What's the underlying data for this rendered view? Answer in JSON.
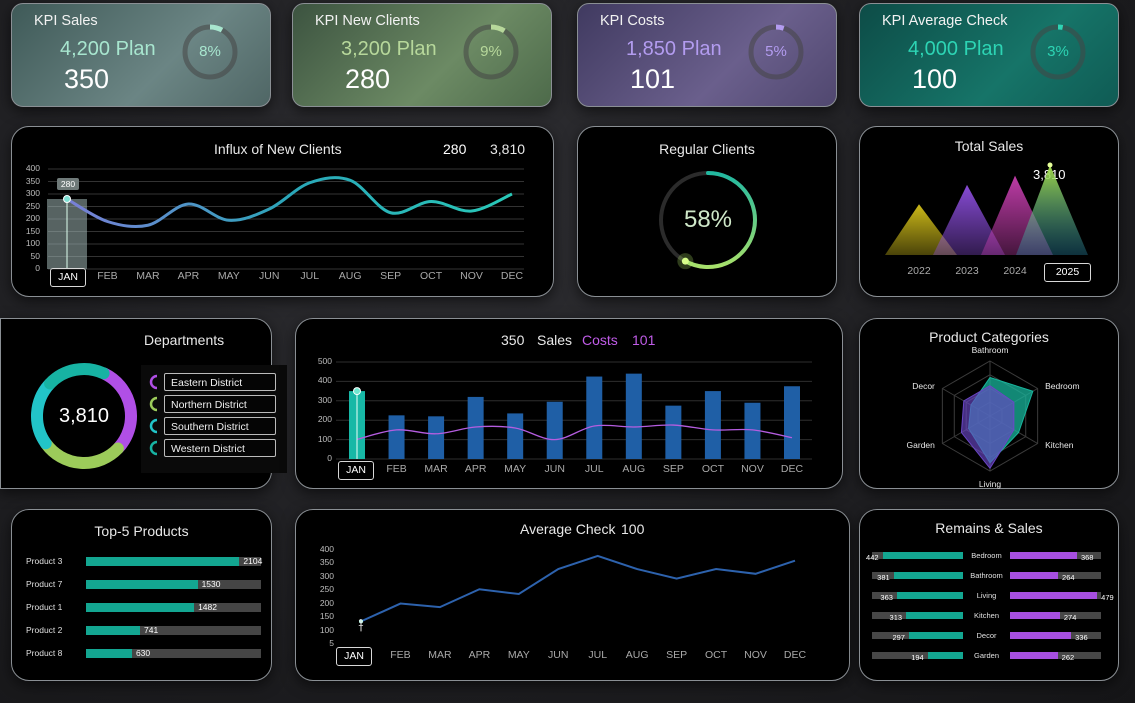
{
  "kpis": [
    {
      "title": "KPI Sales",
      "plan": "4,200 Plan",
      "value": "350",
      "pct": "8%",
      "pct_value": 8,
      "color": "#a8e6cf",
      "grad": "linear-gradient(135deg,#3f5a58,#6b8584 60%,#4f6665)"
    },
    {
      "title": "KPI New Clients",
      "plan": "3,200 Plan",
      "value": "280",
      "pct": "9%",
      "pct_value": 9,
      "color": "#b7d89b",
      "grad": "linear-gradient(135deg,#3c5340,#6c8a64 60%,#4d6a4a)"
    },
    {
      "title": "KPI Costs",
      "plan": "1,850 Plan",
      "value": "101",
      "pct": "5%",
      "pct_value": 5,
      "color": "#b39cf0",
      "grad": "linear-gradient(135deg,#403a60,#6a5f8c 60%,#50476f)"
    },
    {
      "title": "KPI Average Check",
      "plan": "4,000 Plan",
      "value": "100",
      "pct": "3%",
      "pct_value": 3,
      "color": "#2dd4b4",
      "grad": "linear-gradient(135deg,#0d4c47,#167468 60%,#0f5b54)"
    }
  ],
  "influx": {
    "title": "Influx of New Clients",
    "current": "280",
    "total": "3,810",
    "tooltip": "280",
    "y_ticks": [
      "400",
      "350",
      "300",
      "250",
      "200",
      "150",
      "100",
      "50",
      "0"
    ],
    "months": [
      "JAN",
      "FEB",
      "MAR",
      "APR",
      "MAY",
      "JUN",
      "JUL",
      "AUG",
      "SEP",
      "OCT",
      "NOV",
      "DEC"
    ],
    "selected_month": "JAN"
  },
  "regular": {
    "title": "Regular Clients",
    "pct": "58%",
    "pct_value": 58
  },
  "total_sales": {
    "title": "Total Sales",
    "value": "3,810",
    "years": [
      "2022",
      "2023",
      "2024",
      "2025"
    ],
    "selected_year": "2025"
  },
  "departments": {
    "title": "Departments",
    "total": "3,810",
    "items": [
      {
        "label": "Eastern District",
        "color": "#b04fe6"
      },
      {
        "label": "Northern District",
        "color": "#9ccb5a"
      },
      {
        "label": "Southern District",
        "color": "#22c4c8"
      },
      {
        "label": "Western District",
        "color": "#17b3a3"
      }
    ]
  },
  "sales_costs": {
    "sales_value": "350",
    "sales_label": "Sales",
    "costs_label": "Costs",
    "costs_value": "101",
    "y_ticks": [
      "500",
      "400",
      "300",
      "200",
      "100",
      "0"
    ],
    "months": [
      "JAN",
      "FEB",
      "MAR",
      "APR",
      "MAY",
      "JUN",
      "JUL",
      "AUG",
      "SEP",
      "OCT",
      "NOV",
      "DEC"
    ],
    "selected_month": "JAN"
  },
  "product_categories": {
    "title": "Product Categories",
    "axes": [
      "Bathroom",
      "Bedroom",
      "Kitchen",
      "Living",
      "Garden",
      "Decor"
    ]
  },
  "top5": {
    "title": "Top-5 Products",
    "items": [
      {
        "label": "Product 3",
        "value": "2104",
        "num": 2104
      },
      {
        "label": "Product 7",
        "value": "1530",
        "num": 1530
      },
      {
        "label": "Product 1",
        "value": "1482",
        "num": 1482
      },
      {
        "label": "Product 2",
        "value": "741",
        "num": 741
      },
      {
        "label": "Product 8",
        "value": "630",
        "num": 630
      }
    ]
  },
  "avg_check": {
    "title": "Average Check",
    "value": "100",
    "point_label": "1",
    "y_ticks": [
      "400",
      "350",
      "300",
      "250",
      "200",
      "150",
      "100",
      "5"
    ],
    "months": [
      "JAN",
      "FEB",
      "MAR",
      "APR",
      "MAY",
      "JUN",
      "JUL",
      "AUG",
      "SEP",
      "OCT",
      "NOV",
      "DEC"
    ],
    "selected_month": "JAN"
  },
  "remains_sales": {
    "title": "Remains & Sales",
    "rows": [
      {
        "cat": "Bedroom",
        "remain": "442",
        "remain_num": 442,
        "sales": "368",
        "sales_num": 368
      },
      {
        "cat": "Bathroom",
        "remain": "381",
        "remain_num": 381,
        "sales": "264",
        "sales_num": 264
      },
      {
        "cat": "Living",
        "remain": "363",
        "remain_num": 363,
        "sales": "479",
        "sales_num": 479
      },
      {
        "cat": "Kitchen",
        "remain": "313",
        "remain_num": 313,
        "sales": "274",
        "sales_num": 274
      },
      {
        "cat": "Decor",
        "remain": "297",
        "remain_num": 297,
        "sales": "336",
        "sales_num": 336
      },
      {
        "cat": "Garden",
        "remain": "194",
        "remain_num": 194,
        "sales": "262",
        "sales_num": 262
      }
    ]
  },
  "chart_data": [
    {
      "type": "line",
      "title": "Influx of New Clients",
      "categories": [
        "JAN",
        "FEB",
        "MAR",
        "APR",
        "MAY",
        "JUN",
        "JUL",
        "AUG",
        "SEP",
        "OCT",
        "NOV",
        "DEC"
      ],
      "values": [
        280,
        190,
        175,
        260,
        195,
        240,
        345,
        355,
        225,
        270,
        232,
        300
      ],
      "ylim": [
        0,
        400
      ]
    },
    {
      "type": "bar",
      "title": "",
      "categories": [
        "JAN",
        "FEB",
        "MAR",
        "APR",
        "MAY",
        "JUN",
        "JUL",
        "AUG",
        "SEP",
        "OCT",
        "NOV",
        "DEC"
      ],
      "series": [
        {
          "name": "Sales",
          "values": [
            350,
            225,
            220,
            320,
            235,
            295,
            425,
            440,
            275,
            350,
            290,
            375
          ]
        },
        {
          "name": "Costs",
          "values": [
            101,
            150,
            130,
            165,
            160,
            100,
            170,
            165,
            175,
            150,
            150,
            110
          ]
        }
      ],
      "ylim": [
        0,
        500
      ]
    },
    {
      "type": "line",
      "title": "Average Check",
      "categories": [
        "JAN",
        "FEB",
        "MAR",
        "APR",
        "MAY",
        "JUN",
        "JUL",
        "AUG",
        "SEP",
        "OCT",
        "NOV",
        "DEC"
      ],
      "values": [
        100,
        175,
        160,
        235,
        215,
        320,
        375,
        320,
        280,
        320,
        300,
        355
      ],
      "ylim": [
        5,
        400
      ]
    },
    {
      "type": "area",
      "title": "Total Sales",
      "categories": [
        "2022",
        "2023",
        "2024",
        "2025"
      ],
      "values": [
        2150,
        2970,
        3360,
        3810
      ]
    },
    {
      "type": "pie",
      "title": "Departments",
      "categories": [
        "Eastern District",
        "Northern District",
        "Southern District",
        "Western District"
      ],
      "values": [
        30,
        28,
        22,
        20
      ]
    },
    {
      "type": "scatter",
      "title": "Product Categories",
      "categories": [
        "Bathroom",
        "Bedroom",
        "Kitchen",
        "Living",
        "Garden",
        "Decor"
      ],
      "series": [
        {
          "values": [
            0.7,
            0.9,
            0.6,
            0.85,
            0.45,
            0.4
          ]
        },
        {
          "values": [
            0.55,
            0.5,
            0.5,
            0.95,
            0.6,
            0.55
          ]
        }
      ]
    }
  ]
}
